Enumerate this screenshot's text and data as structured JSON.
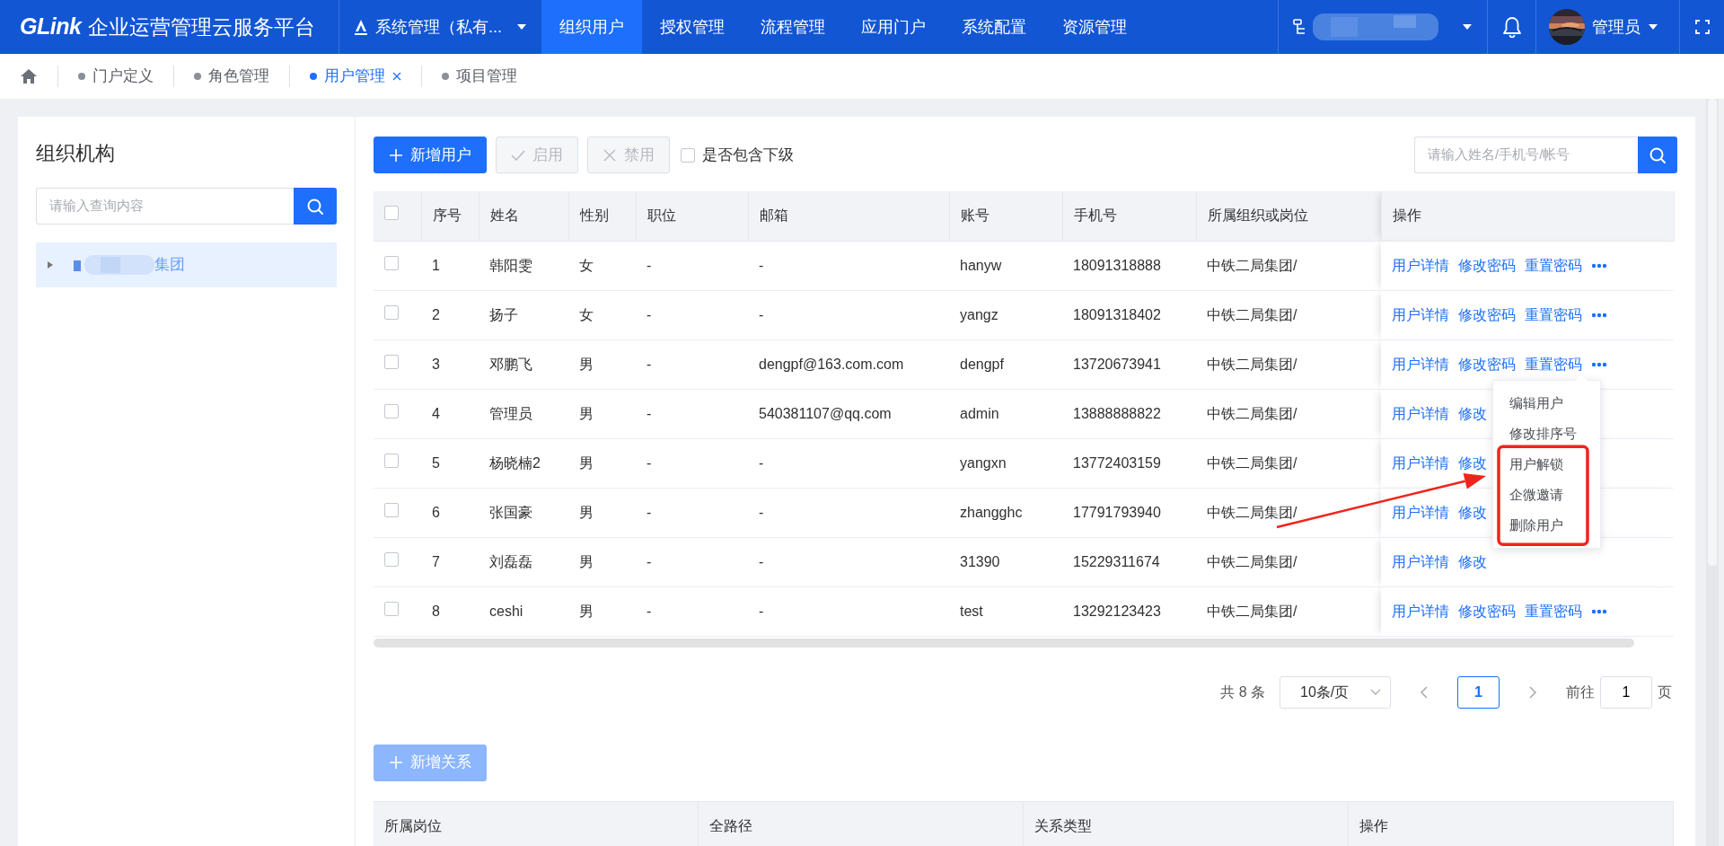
{
  "header": {
    "brand": "GLink",
    "title": "企业运营管理云服务平台",
    "system_selector": "系统管理（私有...",
    "nav": [
      {
        "label": "组织用户",
        "selected": true
      },
      {
        "label": "授权管理",
        "selected": false
      },
      {
        "label": "流程管理",
        "selected": false
      },
      {
        "label": "应用门户",
        "selected": false
      },
      {
        "label": "系统配置",
        "selected": false
      },
      {
        "label": "资源管理",
        "selected": false
      }
    ],
    "user": "管理员"
  },
  "tabs": [
    {
      "label": "门户定义",
      "selected": false
    },
    {
      "label": "角色管理",
      "selected": false
    },
    {
      "label": "用户管理",
      "selected": true
    },
    {
      "label": "项目管理",
      "selected": false
    }
  ],
  "org_panel": {
    "title": "组织机构",
    "search_placeholder": "请输入查询内容",
    "tree": [
      {
        "label": "集团",
        "expanded": false,
        "selected": true
      }
    ]
  },
  "toolbar": {
    "buttons": [
      {
        "label": "新增用户",
        "kind": "add",
        "disabled": false
      },
      {
        "label": "启用",
        "kind": "enable",
        "disabled": true
      },
      {
        "label": "禁用",
        "kind": "disable",
        "disabled": true
      }
    ],
    "include_children": {
      "label": "是否包含下级",
      "checked": false
    },
    "search_placeholder": "请输入姓名/手机号/帐号"
  },
  "users_table": {
    "all_checked": false,
    "columns": [
      "序号",
      "姓名",
      "性别",
      "职位",
      "邮箱",
      "账号",
      "手机号",
      "所属组织或岗位",
      "操作"
    ],
    "rows": [
      {
        "checked": false,
        "cells": [
          "1",
          "韩阳雯",
          "女",
          "-",
          "-",
          "hanyw",
          "18091318888",
          "中铁二局集团/"
        ],
        "actions": [
          "用户详情",
          "修改密码",
          "重置密码"
        ],
        "more": true
      },
      {
        "checked": false,
        "cells": [
          "2",
          "扬子",
          "女",
          "-",
          "-",
          "yangz",
          "18091318402",
          "中铁二局集团/"
        ],
        "actions": [
          "用户详情",
          "修改密码",
          "重置密码"
        ],
        "more": true
      },
      {
        "checked": false,
        "cells": [
          "3",
          "邓鹏飞",
          "男",
          "-",
          "dengpf@163.com.com",
          "dengpf",
          "13720673941",
          "中铁二局集团/"
        ],
        "actions": [
          "用户详情",
          "修改密码",
          "重置密码"
        ],
        "more": true
      },
      {
        "checked": false,
        "cells": [
          "4",
          "管理员",
          "男",
          "-",
          "540381107@qq.com",
          "admin",
          "13888888822",
          "中铁二局集团/"
        ],
        "actions": [
          "用户详情",
          "修改"
        ],
        "more": false
      },
      {
        "checked": false,
        "cells": [
          "5",
          "杨晓楠2",
          "男",
          "-",
          "-",
          "yangxn",
          "13772403159",
          "中铁二局集团/"
        ],
        "actions": [
          "用户详情",
          "修改"
        ],
        "more": false
      },
      {
        "checked": false,
        "cells": [
          "6",
          "张国豪",
          "男",
          "-",
          "-",
          "zhangghc",
          "17791793940",
          "中铁二局集团/"
        ],
        "actions": [
          "用户详情",
          "修改"
        ],
        "more": false
      },
      {
        "checked": false,
        "cells": [
          "7",
          "刘磊磊",
          "男",
          "-",
          "-",
          "31390",
          "15229311674",
          "中铁二局集团/"
        ],
        "actions": [
          "用户详情",
          "修改"
        ],
        "more": false
      },
      {
        "checked": false,
        "cells": [
          "8",
          "ceshi",
          "男",
          "-",
          "-",
          "test",
          "13292123423",
          "中铁二局集团/"
        ],
        "actions": [
          "用户详情",
          "修改密码",
          "重置密码"
        ],
        "more": true
      }
    ]
  },
  "row_menu": {
    "items": [
      {
        "label": "编辑用户",
        "highlighted": false
      },
      {
        "label": "修改排序号",
        "highlighted": false
      },
      {
        "label": "用户解锁",
        "highlighted": true
      },
      {
        "label": "企微邀请",
        "highlighted": true
      },
      {
        "label": "删除用户",
        "highlighted": true
      }
    ]
  },
  "pagination": {
    "total": "共 8 条",
    "page_size": "10条/页",
    "pages": [
      {
        "label": "1",
        "selected": true
      }
    ],
    "goto_label": "前往",
    "goto_value": "1",
    "page_suffix": "页"
  },
  "relations": {
    "add_button": {
      "label": "新增关系",
      "disabled": true
    },
    "columns": [
      "所属岗位",
      "全路径",
      "关系类型",
      "操作"
    ]
  }
}
